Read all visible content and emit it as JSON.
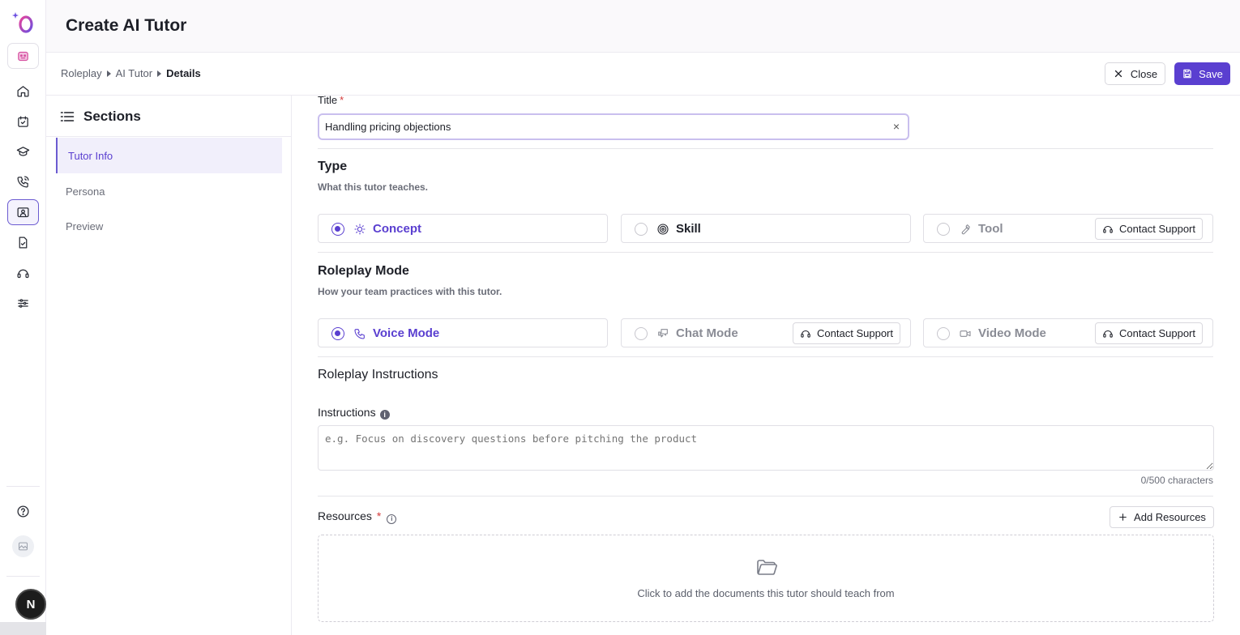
{
  "app": {
    "page_title": "Create AI Tutor",
    "avatar_initial": "N"
  },
  "breadcrumb": [
    "Roleplay",
    "AI Tutor",
    "Details"
  ],
  "actions": {
    "close_label": "Close",
    "save_label": "Save"
  },
  "sections": {
    "heading": "Sections",
    "items": [
      {
        "label": "Tutor Info",
        "active": true
      },
      {
        "label": "Persona",
        "active": false
      },
      {
        "label": "Preview",
        "active": false
      }
    ]
  },
  "form": {
    "title": {
      "label": "Title",
      "required_mark": "*",
      "value": "Handling pricing objections",
      "clear_glyph": "×"
    },
    "type": {
      "heading": "Type",
      "subtitle": "What this tutor teaches.",
      "options": [
        {
          "label": "Concept",
          "icon": "lightbulb-icon",
          "selected": true
        },
        {
          "label": "Skill",
          "icon": "target-icon",
          "selected": false
        },
        {
          "label": "Tool",
          "icon": "wrench-icon",
          "selected": false,
          "disabled": true,
          "support_label": "Contact Support"
        }
      ]
    },
    "mode": {
      "heading": "Roleplay Mode",
      "subtitle": "How your team practices with this tutor.",
      "options": [
        {
          "label": "Voice Mode",
          "icon": "phone-icon",
          "selected": true
        },
        {
          "label": "Chat Mode",
          "icon": "chat-icon",
          "selected": false,
          "disabled": true,
          "support_label": "Contact Support"
        },
        {
          "label": "Video Mode",
          "icon": "video-icon",
          "selected": false,
          "disabled": true,
          "support_label": "Contact Support"
        }
      ]
    },
    "instructions": {
      "section_heading": "Roleplay Instructions",
      "label": "Instructions",
      "placeholder": "e.g. Focus on discovery questions before pitching the product",
      "counter": "0/500 characters"
    },
    "resources": {
      "label": "Resources",
      "required_mark": "*",
      "add_label": "Add Resources",
      "empty_text": "Click to add the documents this tutor should teach from"
    }
  },
  "colors": {
    "accent": "#5a3fd0",
    "required": "#d33b3b"
  }
}
